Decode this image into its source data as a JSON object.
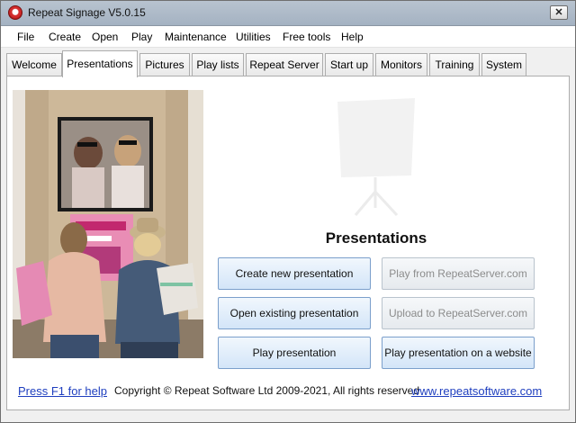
{
  "window": {
    "title": "Repeat Signage V5.0.15",
    "close_label": "✕"
  },
  "menu": [
    "File",
    "Create",
    "Open",
    "Play",
    "Maintenance",
    "Utilities",
    "Free tools",
    "Help"
  ],
  "tabs": [
    "Welcome",
    "Presentations",
    "Pictures",
    "Play lists",
    "Repeat Server",
    "Start up",
    "Monitors",
    "Training",
    "System"
  ],
  "active_tab": "Presentations",
  "panel": {
    "heading": "Presentations",
    "buttons": {
      "create_new": "Create new presentation",
      "open_existing": "Open existing presentation",
      "play": "Play presentation",
      "play_from_server": "Play from RepeatServer.com",
      "upload_to_server": "Upload to RepeatServer.com",
      "play_on_website": "Play presentation on a website"
    },
    "disabled": [
      "play_from_server",
      "upload_to_server"
    ]
  },
  "footer": {
    "help_link": "Press F1 for help",
    "copyright": "Copyright © Repeat Software Ltd 2009-2021, All rights reserved",
    "website_link": "www.repeatsoftware.com"
  },
  "colors": {
    "link": "#1f3fbf",
    "button_border": "#7b9fcb",
    "titlebar": "#b8c3cf"
  }
}
